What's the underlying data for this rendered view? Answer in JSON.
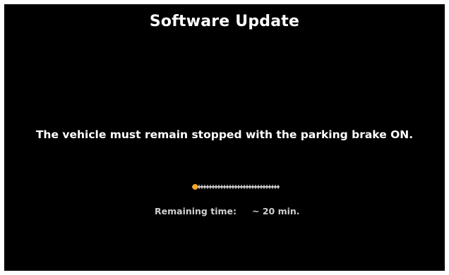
{
  "screen": {
    "title": "Software Update",
    "warning": "The vehicle must remain stopped with the parking brake ON."
  },
  "progress": {
    "value_percent": 2,
    "indicator_color": "#f5a623",
    "track_color": "#ffffff"
  },
  "remaining": {
    "label": "Remaining time:",
    "value": "~ 20 min."
  }
}
